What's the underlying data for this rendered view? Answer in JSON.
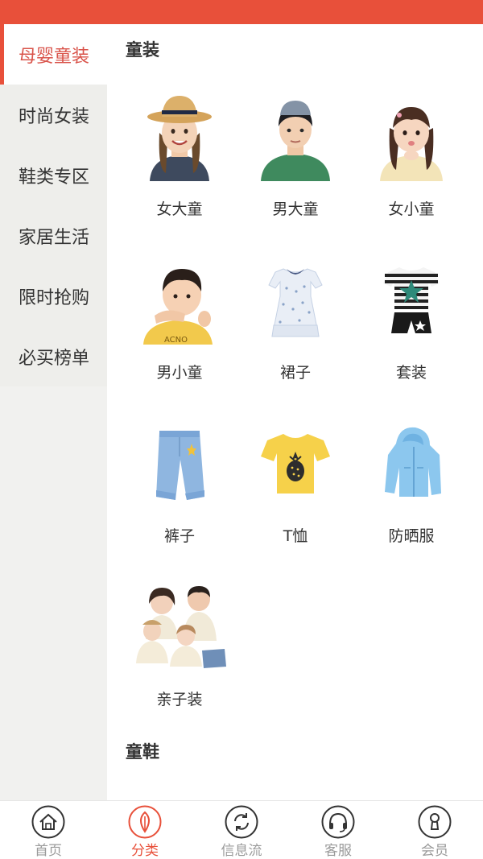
{
  "sidebar": {
    "items": [
      {
        "label": "母婴童装",
        "active": true
      },
      {
        "label": "时尚女装"
      },
      {
        "label": "鞋类专区"
      },
      {
        "label": "家居生活"
      },
      {
        "label": "限时抢购"
      },
      {
        "label": "必买榜单"
      }
    ]
  },
  "main": {
    "section1_title": "童装",
    "section2_title": "童鞋",
    "items": [
      {
        "label": "女大童",
        "image": "girl-with-straw-hat"
      },
      {
        "label": "男大童",
        "image": "boy-with-cap"
      },
      {
        "label": "女小童",
        "image": "little-girl"
      },
      {
        "label": "男小童",
        "image": "little-boy"
      },
      {
        "label": "裙子",
        "image": "dress"
      },
      {
        "label": "套装",
        "image": "striped-outfit-set"
      },
      {
        "label": "裤子",
        "image": "jeans-pants"
      },
      {
        "label": "T恤",
        "image": "yellow-tshirt"
      },
      {
        "label": "防晒服",
        "image": "sun-protection-jacket"
      },
      {
        "label": "亲子装",
        "image": "family-matching-outfits"
      }
    ]
  },
  "tabbar": {
    "items": [
      {
        "label": "首页",
        "icon": "home-icon"
      },
      {
        "label": "分类",
        "icon": "leaf-icon",
        "active": true
      },
      {
        "label": "信息流",
        "icon": "refresh-icon"
      },
      {
        "label": "客服",
        "icon": "headset-icon"
      },
      {
        "label": "会员",
        "icon": "member-icon"
      }
    ]
  },
  "colors": {
    "accent": "#e8503a",
    "active_text": "#d9534a",
    "sidebar_bg": "#eeeeeb",
    "inactive_tab": "#9a9a9a"
  }
}
